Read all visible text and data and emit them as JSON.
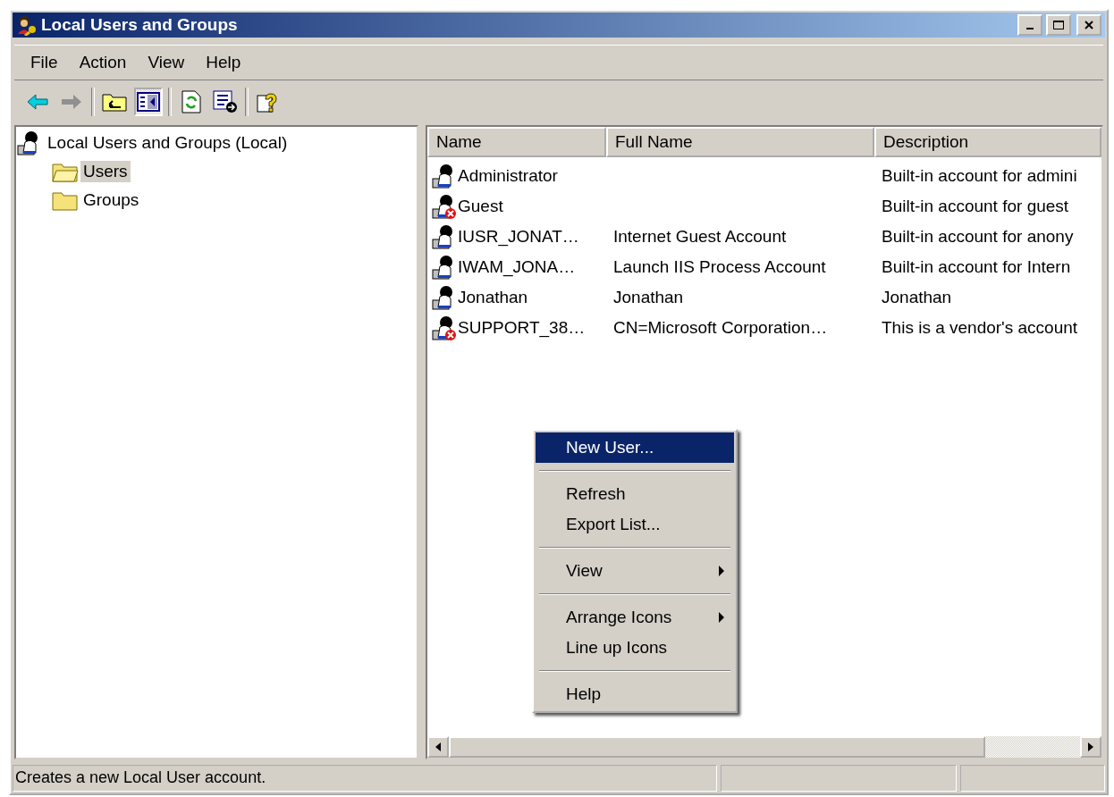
{
  "window": {
    "title": "Local Users and Groups"
  },
  "menu_bar": [
    {
      "label": "File"
    },
    {
      "label": "Action"
    },
    {
      "label": "View"
    },
    {
      "label": "Help"
    }
  ],
  "toolbar": [
    {
      "kind": "back",
      "pressed": false
    },
    {
      "kind": "forward",
      "pressed": false
    },
    {
      "kind": "separator"
    },
    {
      "kind": "up",
      "pressed": false
    },
    {
      "kind": "tree",
      "pressed": true
    },
    {
      "kind": "separator"
    },
    {
      "kind": "refresh",
      "pressed": false
    },
    {
      "kind": "export",
      "pressed": false
    },
    {
      "kind": "separator"
    },
    {
      "kind": "help",
      "pressed": false
    }
  ],
  "tree": {
    "label": "Local Users and Groups (Local)",
    "children": [
      {
        "label": "Users",
        "selected": true,
        "open": true
      },
      {
        "label": "Groups",
        "selected": false,
        "open": false
      }
    ]
  },
  "table": {
    "columns": [
      "Name",
      "Full Name",
      "Description"
    ],
    "rows": [
      {
        "name": "Administrator",
        "full_name": "",
        "description": "Built-in account for admini",
        "disabled": false
      },
      {
        "name": "Guest",
        "full_name": "",
        "description": "Built-in account for guest",
        "disabled": true
      },
      {
        "name": "IUSR_JONAT…",
        "full_name": "Internet Guest Account",
        "description": "Built-in account for anony",
        "disabled": false
      },
      {
        "name": "IWAM_JONA…",
        "full_name": "Launch IIS Process Account",
        "description": "Built-in account for Intern",
        "disabled": false
      },
      {
        "name": "Jonathan",
        "full_name": "Jonathan",
        "description": "Jonathan",
        "disabled": false
      },
      {
        "name": "SUPPORT_38…",
        "full_name": "CN=Microsoft Corporation…",
        "description": "This is a vendor's account",
        "disabled": true
      }
    ]
  },
  "context_menu": [
    {
      "kind": "item",
      "label": "New User...",
      "selected": true,
      "submenu": false
    },
    {
      "kind": "separator"
    },
    {
      "kind": "item",
      "label": "Refresh",
      "selected": false,
      "submenu": false
    },
    {
      "kind": "item",
      "label": "Export List...",
      "selected": false,
      "submenu": false
    },
    {
      "kind": "separator"
    },
    {
      "kind": "item",
      "label": "View",
      "selected": false,
      "submenu": true
    },
    {
      "kind": "separator"
    },
    {
      "kind": "item",
      "label": "Arrange Icons",
      "selected": false,
      "submenu": true
    },
    {
      "kind": "item",
      "label": "Line up Icons",
      "selected": false,
      "submenu": false
    },
    {
      "kind": "separator"
    },
    {
      "kind": "item",
      "label": "Help",
      "selected": false,
      "submenu": false
    }
  ],
  "status_bar": {
    "text": "Creates a new Local User account."
  }
}
